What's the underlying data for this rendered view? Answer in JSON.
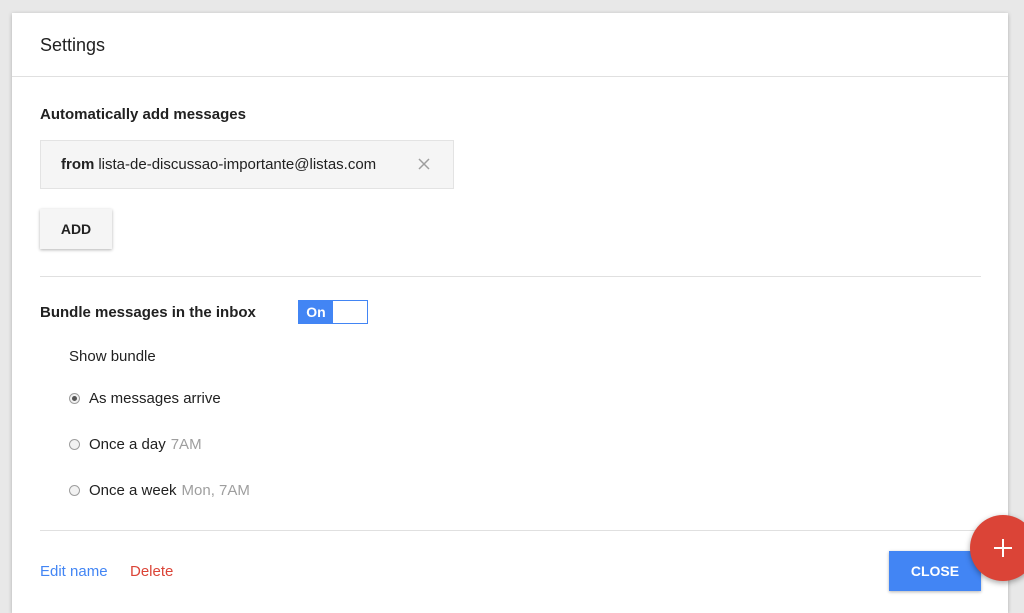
{
  "dialog": {
    "title": "Settings"
  },
  "auto_add": {
    "heading": "Automatically add messages",
    "filter": {
      "keyword": "from",
      "value": "lista-de-discussao-importante@listas.com"
    },
    "add_button_label": "ADD"
  },
  "bundle": {
    "heading": "Bundle messages in the inbox",
    "toggle_label": "On",
    "toggle_state": "on",
    "show_label": "Show bundle",
    "options": [
      {
        "label": "As messages arrive",
        "hint": "",
        "selected": true
      },
      {
        "label": "Once a day",
        "hint": "7AM",
        "selected": false
      },
      {
        "label": "Once a week",
        "hint": "Mon, 7AM",
        "selected": false
      }
    ]
  },
  "footer": {
    "edit_name_label": "Edit name",
    "delete_label": "Delete",
    "close_label": "CLOSE"
  },
  "icons": {
    "chip_remove": "close-icon",
    "fab": "plus-icon"
  },
  "colors": {
    "accent": "#4285f4",
    "danger": "#db4437"
  }
}
